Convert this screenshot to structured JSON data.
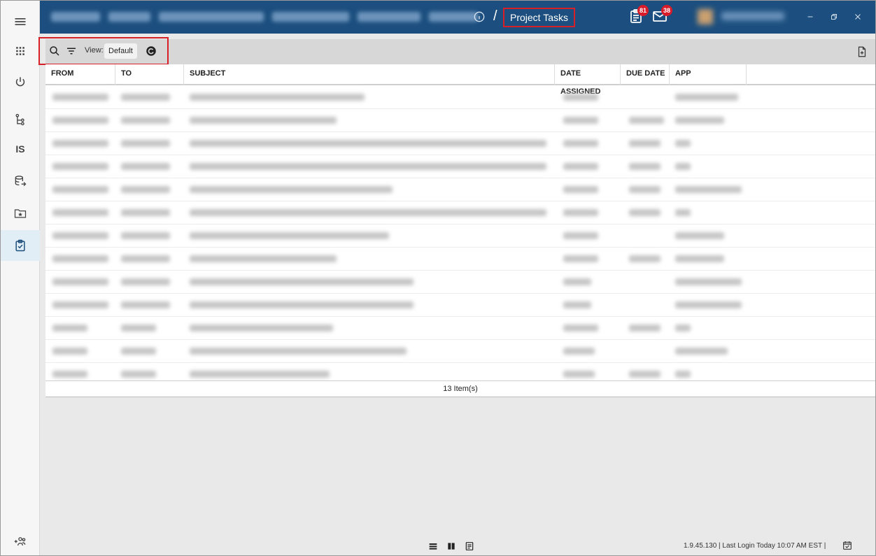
{
  "header": {
    "page_title": "Project Tasks",
    "notifications": {
      "tasks_badge": "81",
      "mail_badge": "38"
    }
  },
  "rail": {
    "items": [
      {
        "icon": "hamburger-menu-icon"
      },
      {
        "icon": "apps-grid-icon"
      },
      {
        "icon": "power-icon"
      },
      {
        "icon": "workflow-tree-icon"
      },
      {
        "icon": "is-text-icon",
        "text": "IS"
      },
      {
        "icon": "database-export-icon"
      },
      {
        "icon": "favorite-folder-icon"
      },
      {
        "icon": "clipboard-check-icon",
        "active": true
      },
      {
        "icon": "add-group-icon"
      }
    ]
  },
  "toolbar": {
    "view_label": "View:",
    "view_value": "Default"
  },
  "grid": {
    "columns": [
      "FROM",
      "TO",
      "SUBJECT",
      "DATE ASSIGNED",
      "DUE DATE",
      "APP"
    ],
    "rows_redacted": true,
    "footer": "13 Item(s)"
  },
  "status": {
    "text": "1.9.45.130  |  Last Login Today 10:07 AM EST  |"
  },
  "colors": {
    "topbar": "#1c4f7f",
    "highlight_box": "#d61f26",
    "badge": "#d81c2a",
    "active_rail": "#e2eef6"
  }
}
